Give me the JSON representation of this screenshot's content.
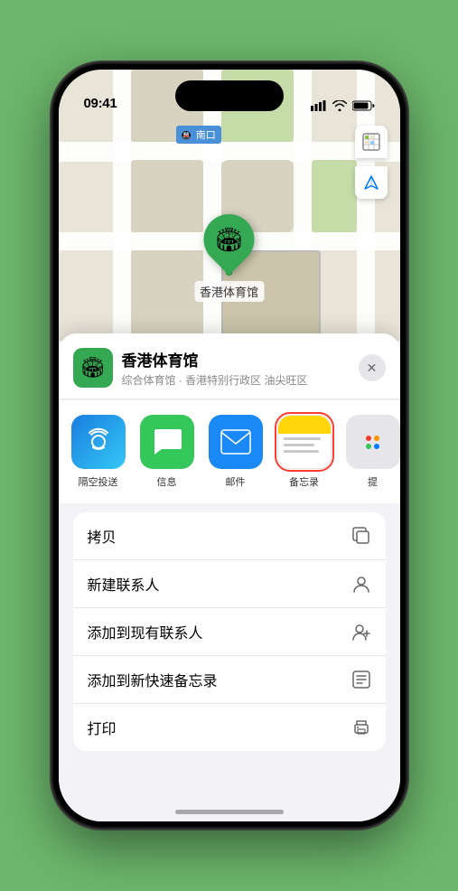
{
  "statusBar": {
    "time": "09:41",
    "timeIcon": "location-arrow-icon"
  },
  "mapLabels": {
    "entrance": "南口"
  },
  "mapControls": {
    "mapViewIcon": "🗺",
    "locationIcon": "↗"
  },
  "marker": {
    "label": "香港体育馆",
    "emoji": "🏟"
  },
  "sheet": {
    "venueName": "香港体育馆",
    "venueSubtitle": "综合体育馆 · 香港特别行政区 油尖旺区",
    "closeLabel": "✕"
  },
  "shareItems": [
    {
      "id": "airdrop",
      "label": "隔空投送",
      "type": "airdrop"
    },
    {
      "id": "message",
      "label": "信息",
      "type": "message"
    },
    {
      "id": "mail",
      "label": "邮件",
      "type": "mail"
    },
    {
      "id": "notes",
      "label": "备忘录",
      "type": "notes",
      "selected": true
    },
    {
      "id": "more",
      "label": "提",
      "type": "more"
    }
  ],
  "actions": [
    {
      "id": "copy",
      "label": "拷贝",
      "icon": "copy"
    },
    {
      "id": "new-contact",
      "label": "新建联系人",
      "icon": "person"
    },
    {
      "id": "add-existing",
      "label": "添加到现有联系人",
      "icon": "person-add"
    },
    {
      "id": "add-notes",
      "label": "添加到新快速备忘录",
      "icon": "notes"
    },
    {
      "id": "print",
      "label": "打印",
      "icon": "print"
    }
  ]
}
